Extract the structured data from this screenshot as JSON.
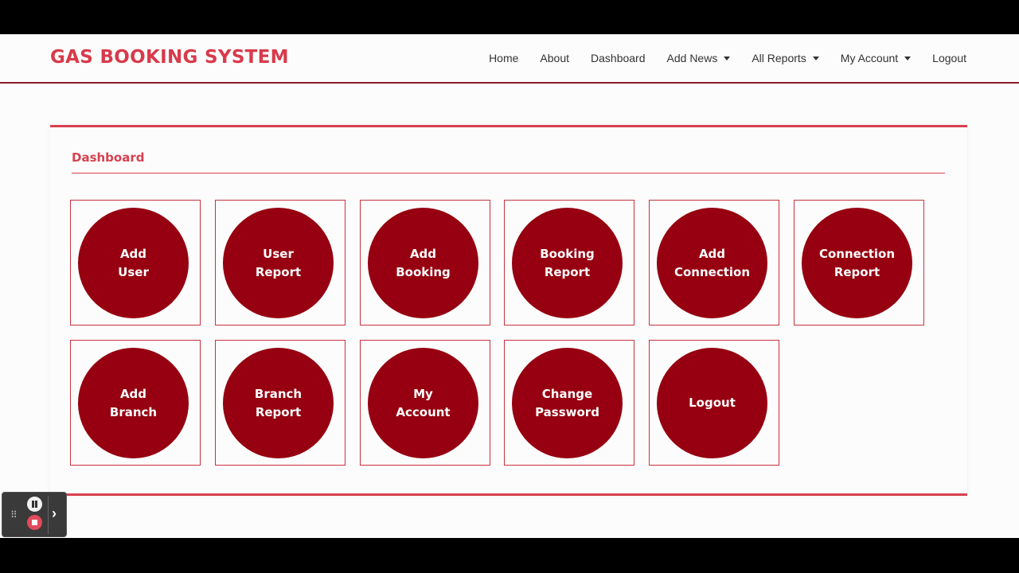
{
  "brand": "GAS BOOKING SYSTEM",
  "nav": [
    {
      "label": "Home",
      "dropdown": false
    },
    {
      "label": "About",
      "dropdown": false
    },
    {
      "label": "Dashboard",
      "dropdown": false
    },
    {
      "label": "Add News",
      "dropdown": true
    },
    {
      "label": "All Reports",
      "dropdown": true
    },
    {
      "label": "My Account",
      "dropdown": true
    },
    {
      "label": "Logout",
      "dropdown": false
    }
  ],
  "dashboard": {
    "title": "Dashboard",
    "tiles": [
      {
        "label": "Add\nUser"
      },
      {
        "label": "User\nReport"
      },
      {
        "label": "Add\nBooking"
      },
      {
        "label": "Booking\nReport"
      },
      {
        "label": "Add\nConnection"
      },
      {
        "label": "Connection\nReport"
      },
      {
        "label": "Add\nBranch"
      },
      {
        "label": "Branch\nReport"
      },
      {
        "label": "My\nAccount"
      },
      {
        "label": "Change\nPassword"
      },
      {
        "label": "Logout"
      }
    ]
  },
  "colors": {
    "accent": "#d8414f",
    "tile_circle": "#960010",
    "header_rule": "#8d1a2a"
  },
  "recorder": {
    "icons": [
      "drag-handle-icon",
      "pause-icon",
      "stop-icon",
      "chevron-right-icon"
    ]
  }
}
